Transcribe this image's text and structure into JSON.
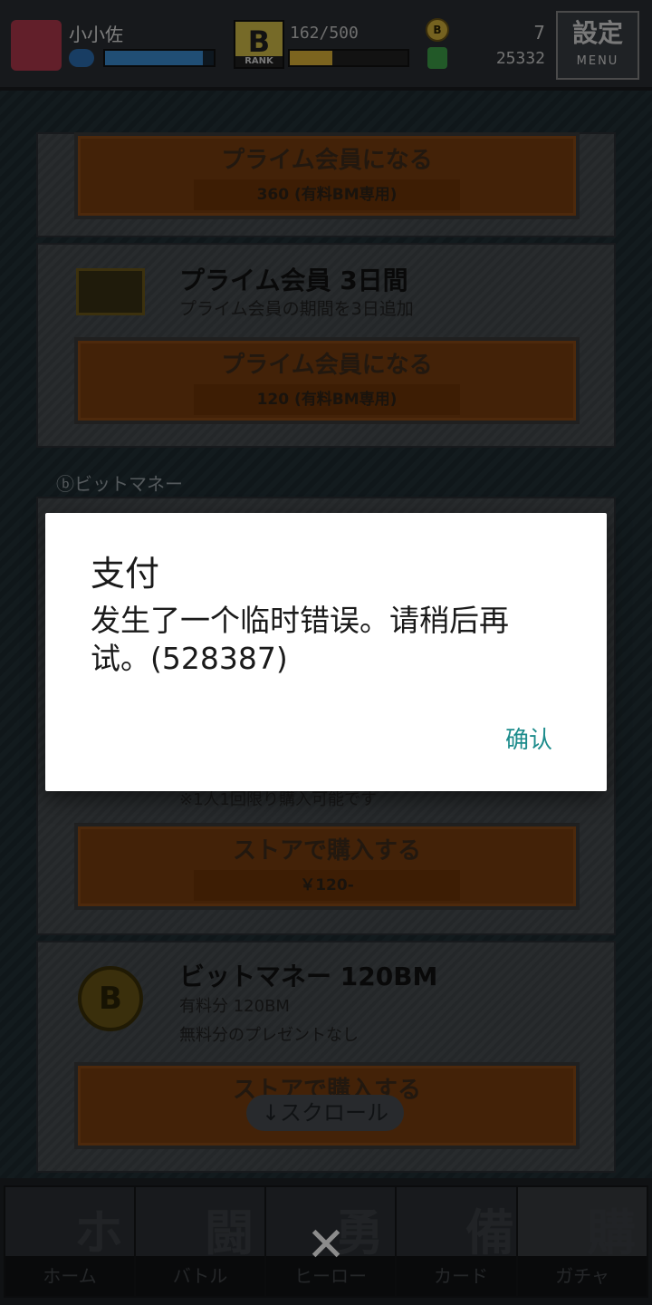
{
  "topbar": {
    "player_name": "小小佐",
    "exp": "162/500",
    "gold_count": "7",
    "bm_count": "25332",
    "rank_letter": "B",
    "rank_sub": "RANK",
    "settings_label": "設定",
    "settings_sub": "MENU"
  },
  "cards": [
    {
      "button_label": "プライム会員になる",
      "button_price": "360 (有料BM専用)"
    },
    {
      "title": "プライム会員 3日間",
      "desc": "プライム会員の期間を3日追加",
      "button_label": "プライム会員になる",
      "button_price": "120 (有料BM専用)"
    }
  ],
  "section_label": "ⓑビットマネー",
  "hidden_card": {
    "note": "※1人1回限り購入可能です",
    "button_label": "ストアで購入する",
    "button_price": "￥120-"
  },
  "bm_card": {
    "title": "ビットマネー 120BM",
    "line1": "有料分 120BM",
    "line2": "無料分のプレゼントなし",
    "button_label": "ストアで購入する"
  },
  "scroll_hint": "↓スクロール",
  "bottom_nav": [
    {
      "kanji": "ホ",
      "label": "ホーム"
    },
    {
      "kanji": "闘",
      "label": "バトル"
    },
    {
      "kanji": "勇",
      "label": "ヒーロー"
    },
    {
      "kanji": "備",
      "label": "カード"
    },
    {
      "kanji": "購",
      "label": "ガチャ"
    }
  ],
  "close_symbol": "✕",
  "dialog": {
    "title": "支付",
    "message": "发生了一个临时错误。请稍后再试。(528387)",
    "confirm": "确认"
  }
}
